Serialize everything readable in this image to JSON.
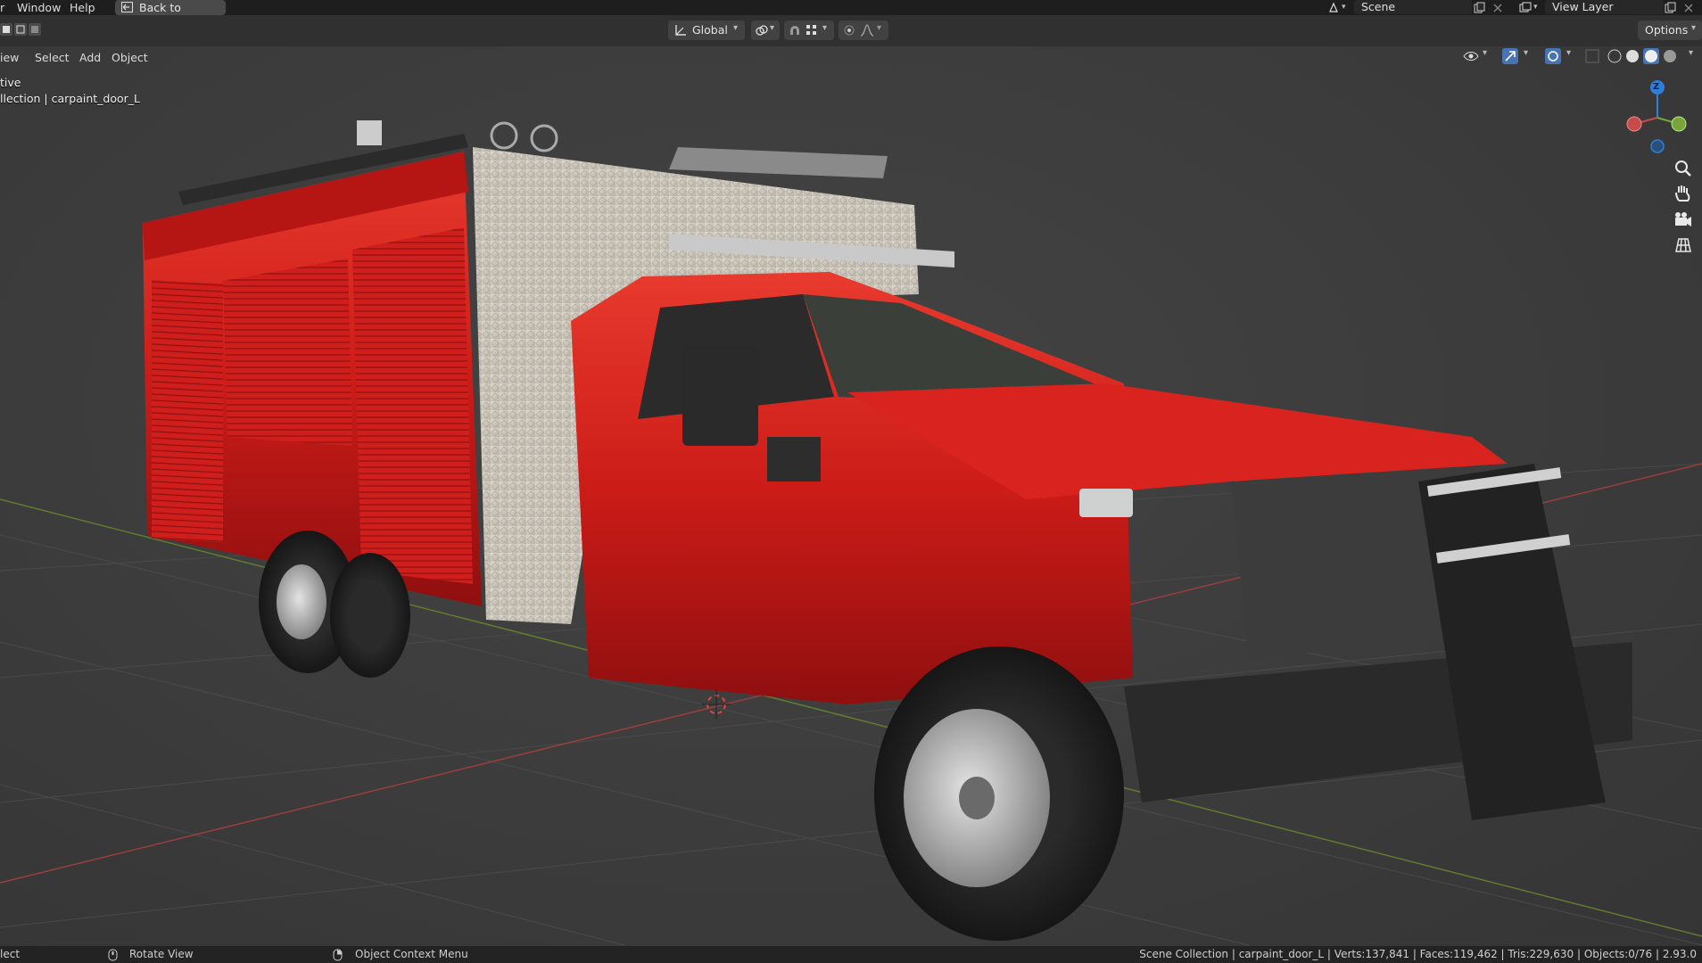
{
  "topbar": {
    "menu": [
      "r",
      "Window",
      "Help"
    ],
    "back_button": "Back to Previous",
    "scene_field": "Scene",
    "view_layer_field": "View Layer"
  },
  "header": {
    "transform_orientation": "Global",
    "options": "Options"
  },
  "viewport_menu": [
    "iew",
    "Select",
    "Add",
    "Object"
  ],
  "viewport_info": {
    "mode_line": "tive",
    "selection_line": "llection | carpaint_door_L"
  },
  "gizmo": {
    "z_label": "Z"
  },
  "statusbar": {
    "left_action": "lect",
    "middle_action": "Rotate View",
    "right_action": "Object Context Menu",
    "stats": "Scene Collection | carpaint_door_L | Verts:137,841 | Faces:119,462 | Tris:229,630 | Objects:0/76 | 2.93.0"
  },
  "colors": {
    "truck_red": "#d31d1b",
    "body_panel": "#d4cfc4",
    "x_axis": "#c84b4b",
    "y_axis": "#7aa33a",
    "z_axis": "#2f7fd8"
  }
}
